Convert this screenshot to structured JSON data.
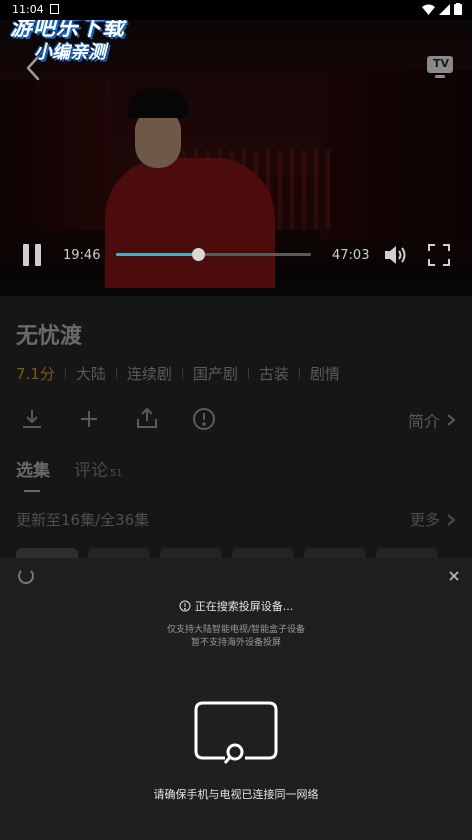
{
  "status_bar": {
    "time": "11:04"
  },
  "watermark": {
    "line1": "游吧乐下载",
    "line2": "小编亲测"
  },
  "player": {
    "current_time": "19:46",
    "total_time": "47:03",
    "progress_fraction": 0.42,
    "tv_label": "TV"
  },
  "show": {
    "title": "无忧渡",
    "score": "7.1分",
    "tags": [
      "大陆",
      "连续剧",
      "国产剧",
      "古装",
      "剧情"
    ],
    "brief_label": "简介"
  },
  "tabs": {
    "episodes": "选集",
    "comments": "评论",
    "comments_count": "51"
  },
  "episodes": {
    "update_text": "更新至16集/全36集",
    "more_label": "更多"
  },
  "cast_sheet": {
    "searching_text": "正在搜索投屏设备...",
    "note_line1": "仅支持大陆智能电视/智能盒子设备",
    "note_line2": "暂不支持海外设备投屏",
    "network_tip": "请确保手机与电视已连接同一网络"
  },
  "colors": {
    "accent": "#3fb2c6",
    "score": "#7a5c14",
    "sheet_bg": "#1f1f1f"
  }
}
